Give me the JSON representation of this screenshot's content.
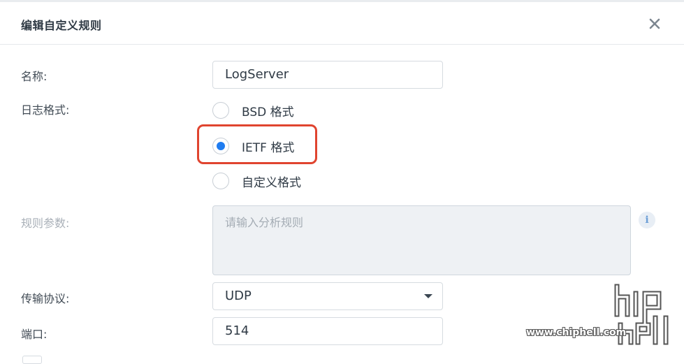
{
  "dialog": {
    "title": "编辑自定义规则",
    "close_icon": "close-icon"
  },
  "form": {
    "name": {
      "label": "名称:",
      "value": "LogServer"
    },
    "log_format": {
      "label": "日志格式:",
      "options": [
        {
          "label": "BSD 格式",
          "checked": false
        },
        {
          "label": "IETF 格式",
          "checked": true
        },
        {
          "label": "自定义格式",
          "checked": false
        }
      ]
    },
    "rule_params": {
      "label": "规则参数:",
      "placeholder": "请输入分析规则",
      "info_icon": "info-icon",
      "disabled": true
    },
    "protocol": {
      "label": "传输协议:",
      "value": "UDP"
    },
    "port": {
      "label": "端口:",
      "value": "514"
    }
  },
  "watermark": {
    "text": "www.chiphell.com"
  },
  "colors": {
    "accent": "#1f7cf0",
    "highlight": "#e0442f"
  }
}
